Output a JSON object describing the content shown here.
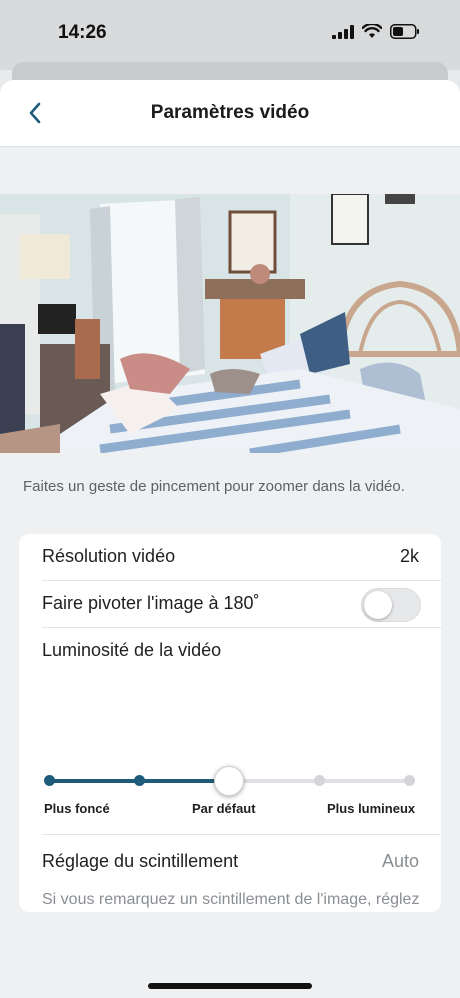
{
  "status_bar": {
    "time": "14:26"
  },
  "nav": {
    "title": "Paramètres vidéo"
  },
  "hint": "Faites un geste de pincement pour zoomer dans la vidéo.",
  "settings": {
    "resolution": {
      "label": "Résolution vidéo",
      "value": "2k"
    },
    "rotate": {
      "label": "Faire pivoter l'image à 180˚",
      "enabled": false
    },
    "brightness": {
      "label": "Luminosité de la vidéo",
      "steps": 5,
      "selected_index": 2,
      "min_label": "Plus foncé",
      "default_label": "Par défaut",
      "max_label": "Plus lumineux"
    },
    "flicker": {
      "label": "Réglage du scintillement",
      "value": "Auto",
      "description": "Si vous remarquez un scintillement de l'image, réglez la vitesse d'obturation de votre caméra de sorte qu'elle corresponde à la fréquence de votre alimentation CA locale."
    }
  },
  "colors": {
    "accent": "#1f5b7a",
    "muted_dot": "#d3d5d8"
  }
}
